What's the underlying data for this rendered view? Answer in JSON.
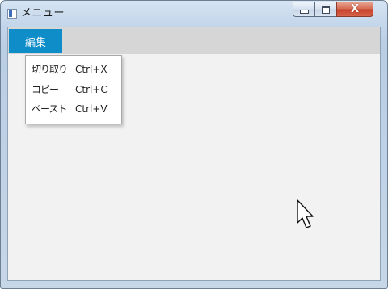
{
  "window": {
    "title": "メニュー",
    "close_glyph": "X"
  },
  "menubar": {
    "items": [
      {
        "label": "編集"
      }
    ]
  },
  "dropdown": {
    "items": [
      {
        "label": "切り取り",
        "shortcut": "Ctrl+X"
      },
      {
        "label": "コピー",
        "shortcut": "Ctrl+C"
      },
      {
        "label": "ペースト",
        "shortcut": "Ctrl+V"
      }
    ]
  },
  "colors": {
    "menu_highlight": "#0f8dc8",
    "menubar_bg": "#d6d6d6",
    "client_bg": "#f2f2f2",
    "close_button": "#c6402a"
  },
  "icons": {
    "app": "window-app-icon",
    "cursor": "mouse-pointer-icon"
  }
}
